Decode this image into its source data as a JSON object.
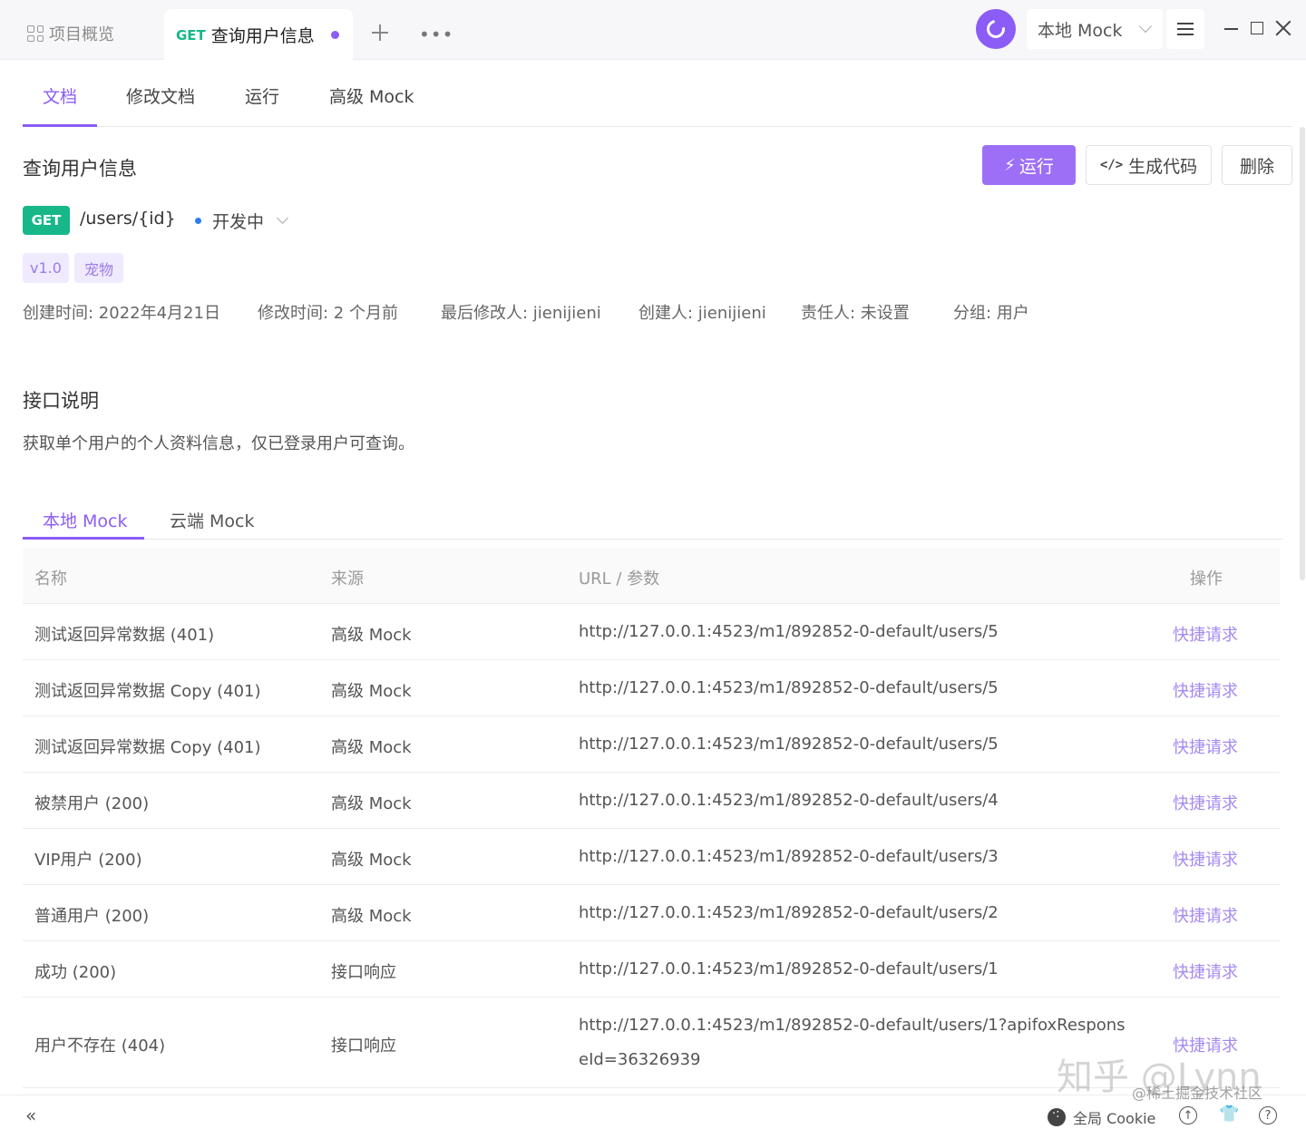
{
  "titlebar": {
    "overview_tab": "项目概览",
    "active_tab": {
      "method": "GET",
      "title": "查询用户信息"
    },
    "environment": "本地 Mock"
  },
  "subtabs": [
    "文档",
    "修改文档",
    "运行",
    "高级 Mock"
  ],
  "api": {
    "title": "查询用户信息",
    "method": "GET",
    "path": "/users/{id}",
    "status": "开发中",
    "tags": [
      "v1.0",
      "宠物"
    ],
    "meta": [
      "创建时间: 2022年4月21日",
      "修改时间: 2 个月前",
      "最后修改人: jienijieni",
      "创建人: jienijieni",
      "责任人: 未设置",
      "分组: 用户"
    ]
  },
  "actions": {
    "run": "运行",
    "gen_code": "生成代码",
    "delete": "删除"
  },
  "description": {
    "title": "接口说明",
    "text": "获取单个用户的个人资料信息，仅已登录用户可查询。"
  },
  "mock_tabs": [
    "本地 Mock",
    "云端 Mock"
  ],
  "table": {
    "headers": [
      "名称",
      "来源",
      "URL / 参数",
      "操作"
    ],
    "rows": [
      {
        "name": "测试返回异常数据 (401)",
        "source": "高级 Mock",
        "url": "http://127.0.0.1:4523/m1/892852-0-default/users/5",
        "action": "快捷请求"
      },
      {
        "name": "测试返回异常数据 Copy (401)",
        "source": "高级 Mock",
        "url": "http://127.0.0.1:4523/m1/892852-0-default/users/5",
        "action": "快捷请求"
      },
      {
        "name": "测试返回异常数据 Copy (401)",
        "source": "高级 Mock",
        "url": "http://127.0.0.1:4523/m1/892852-0-default/users/5",
        "action": "快捷请求"
      },
      {
        "name": "被禁用户 (200)",
        "source": "高级 Mock",
        "url": "http://127.0.0.1:4523/m1/892852-0-default/users/4",
        "action": "快捷请求"
      },
      {
        "name": "VIP用户 (200)",
        "source": "高级 Mock",
        "url": "http://127.0.0.1:4523/m1/892852-0-default/users/3",
        "action": "快捷请求"
      },
      {
        "name": "普通用户 (200)",
        "source": "高级 Mock",
        "url": "http://127.0.0.1:4523/m1/892852-0-default/users/2",
        "action": "快捷请求"
      },
      {
        "name": "成功 (200)",
        "source": "接口响应",
        "url": "http://127.0.0.1:4523/m1/892852-0-default/users/1",
        "action": "快捷请求"
      },
      {
        "name": "用户不存在 (404)",
        "source": "接口响应",
        "url": "http://127.0.0.1:4523/m1/892852-0-default/users/1?apifoxResponseId=36326939",
        "action": "快捷请求"
      }
    ]
  },
  "footer": {
    "cookie": "全局 Cookie"
  },
  "watermark": {
    "main": "知乎 @Lynn",
    "sub": "@稀土掘金技术社区"
  },
  "colors": {
    "accent": "#8b5cf6",
    "get": "#17b78a"
  }
}
